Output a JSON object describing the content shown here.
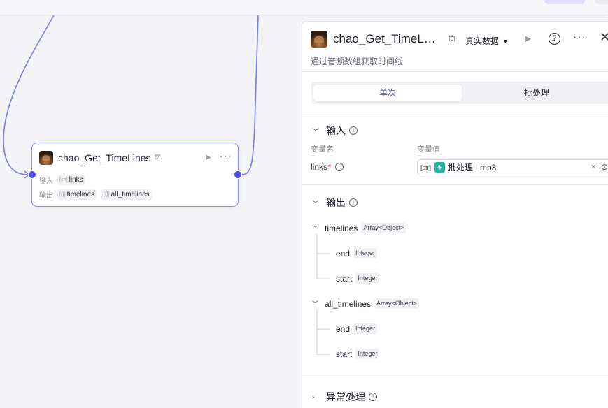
{
  "canvas": {
    "node": {
      "title": "chao_Get_TimeLines",
      "input_label": "输入",
      "output_label": "输出",
      "inputs": [
        {
          "icon": "[str]",
          "name": "links"
        }
      ],
      "outputs": [
        {
          "icon": "[{}]",
          "name": "timelines"
        },
        {
          "icon": "[{}]",
          "name": "all_timelines"
        }
      ]
    }
  },
  "panel": {
    "title": "chao_Get_TimeLines",
    "mode": "真实数据",
    "description": "通过音频数组获取时间线",
    "tabs": [
      {
        "label": "单次"
      },
      {
        "label": "批处理"
      }
    ],
    "input_section": {
      "title": "输入",
      "col_name": "变量名",
      "col_value": "变量值",
      "params": [
        {
          "name": "links",
          "required_mark": "*",
          "type_badge": "[str]",
          "value_source": "批处理",
          "value_sep": "·",
          "value_field": "mp3"
        }
      ]
    },
    "output_section": {
      "title": "输出",
      "fields": [
        {
          "name": "timelines",
          "type": "Array<Object>",
          "children": [
            {
              "name": "end",
              "type": "Integer"
            },
            {
              "name": "start",
              "type": "Integer"
            }
          ]
        },
        {
          "name": "all_timelines",
          "type": "Array<Object>",
          "children": [
            {
              "name": "end",
              "type": "Integer"
            },
            {
              "name": "start",
              "type": "Integer"
            }
          ]
        }
      ]
    },
    "error_section": {
      "title": "异常处理"
    }
  },
  "colors": {
    "accent": "#4d53e8",
    "port": "#4f4fe6",
    "edge": "#7b7bf0",
    "batch": "#1fb6a6"
  }
}
